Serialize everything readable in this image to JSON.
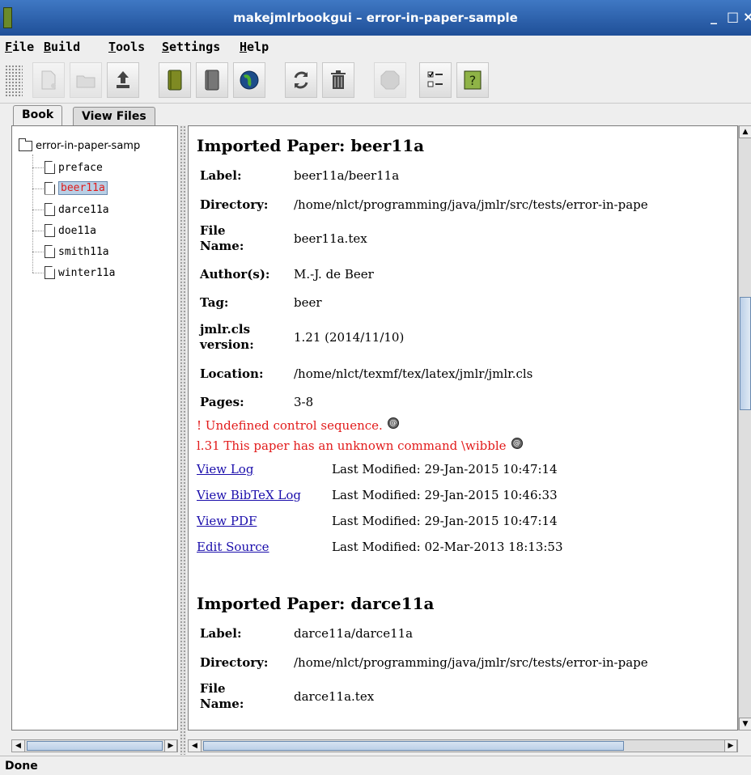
{
  "window": {
    "title": "makejmlrbookgui – error-in-paper-sample",
    "controls": {
      "minimize": "_",
      "maximize": "□",
      "close": "×"
    }
  },
  "menubar": {
    "items": [
      {
        "mnemonic": "F",
        "rest": "ile"
      },
      {
        "mnemonic": "B",
        "rest": "uild"
      },
      {
        "mnemonic": "T",
        "rest": "ools"
      },
      {
        "mnemonic": "S",
        "rest": "ettings"
      },
      {
        "mnemonic": "H",
        "rest": "elp"
      }
    ]
  },
  "toolbar": {
    "icons": [
      "new-file-icon",
      "open-folder-icon",
      "export-icon",
      "book-green-icon",
      "book-gray-icon",
      "globe-icon",
      "refresh-icon",
      "trash-icon",
      "stop-icon",
      "checklist-icon",
      "help-icon"
    ]
  },
  "tabs": [
    {
      "label": "Book"
    },
    {
      "label": "View Files"
    }
  ],
  "tree": {
    "root": "error-in-paper-samp",
    "items": [
      {
        "label": "preface"
      },
      {
        "label": "beer11a"
      },
      {
        "label": "darce11a"
      },
      {
        "label": "doe11a"
      },
      {
        "label": "smith11a"
      },
      {
        "label": "winter11a"
      }
    ]
  },
  "papers": [
    {
      "heading": "Imported Paper: beer11a",
      "rows": [
        {
          "k": "Label:",
          "v": "beer11a/beer11a"
        },
        {
          "k": "Directory:",
          "v": "/home/nlct/programming/java/jmlr/src/tests/error-in-pape"
        },
        {
          "k": "File Name:",
          "v": "beer11a.tex"
        },
        {
          "k": "Author(s):",
          "v": "M.-J. de Beer"
        },
        {
          "k": "Tag:",
          "v": "beer"
        },
        {
          "k": "jmlr.cls version:",
          "v": "1.21 (2014/11/10)"
        },
        {
          "k": "Location:",
          "v": "/home/nlct/texmf/tex/latex/jmlr/jmlr.cls"
        },
        {
          "k": "Pages:",
          "v": "3-8"
        }
      ],
      "errors": [
        {
          "text": "! Undefined control sequence.",
          "badge": "@"
        },
        {
          "text": "l.31 This paper has an unknown command \\wibble",
          "badge": "@"
        }
      ],
      "links": [
        {
          "link": "View Log",
          "modified": "Last Modified: 29-Jan-2015 10:47:14"
        },
        {
          "link": "View BibTeX Log",
          "modified": "Last Modified: 29-Jan-2015 10:46:33"
        },
        {
          "link": "View PDF",
          "modified": "Last Modified: 29-Jan-2015 10:47:14"
        },
        {
          "link": "Edit Source",
          "modified": "Last Modified: 02-Mar-2013 18:13:53"
        }
      ]
    },
    {
      "heading": "Imported Paper: darce11a",
      "rows": [
        {
          "k": "Label:",
          "v": "darce11a/darce11a"
        },
        {
          "k": "Directory:",
          "v": "/home/nlct/programming/java/jmlr/src/tests/error-in-pape"
        },
        {
          "k": "File Name:",
          "v": "darce11a.tex"
        }
      ]
    }
  ],
  "status": {
    "text": "Done"
  }
}
